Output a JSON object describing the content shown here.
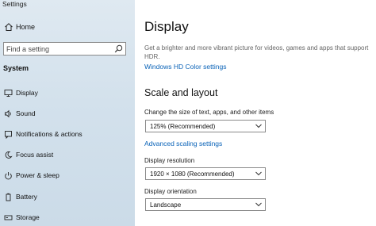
{
  "app": {
    "title": "Settings"
  },
  "sidebar": {
    "home_label": "Home",
    "search_placeholder": "Find a setting",
    "section_title": "System",
    "items": [
      {
        "label": "Display",
        "icon": "monitor-icon"
      },
      {
        "label": "Sound",
        "icon": "speaker-icon"
      },
      {
        "label": "Notifications & actions",
        "icon": "notification-icon"
      },
      {
        "label": "Focus assist",
        "icon": "moon-icon"
      },
      {
        "label": "Power & sleep",
        "icon": "power-icon"
      },
      {
        "label": "Battery",
        "icon": "battery-icon"
      },
      {
        "label": "Storage",
        "icon": "storage-icon"
      }
    ]
  },
  "main": {
    "title": "Display",
    "description": "Get a brighter and more vibrant picture for videos, games and apps that support HDR.",
    "hdr_link": "Windows HD Color settings",
    "scale_heading": "Scale and layout",
    "scale_label": "Change the size of text, apps, and other items",
    "scale_value": "125% (Recommended)",
    "advanced_link": "Advanced scaling settings",
    "resolution_label": "Display resolution",
    "resolution_value": "1920 × 1080 (Recommended)",
    "orientation_label": "Display orientation",
    "orientation_value": "Landscape"
  },
  "colors": {
    "accent": "#0a63b8",
    "sidebar_bg": "#d3e1ec"
  }
}
